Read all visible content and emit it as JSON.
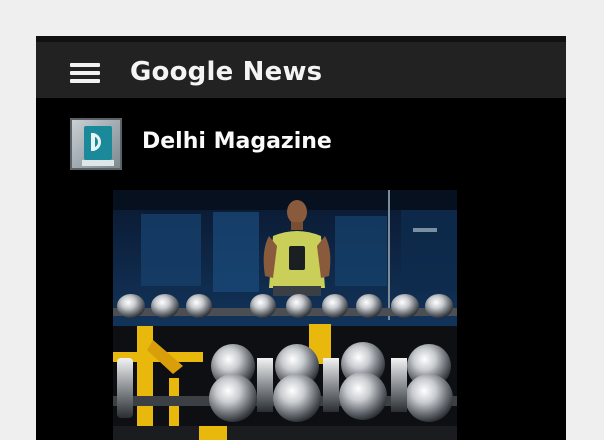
{
  "header": {
    "title": "Google News",
    "menu_icon": "hamburger-menu-icon"
  },
  "publisher": {
    "name": "Delhi Magazine",
    "logo_icon": "publisher-logo-icon"
  },
  "article": {
    "image_subject": "gym-mirror-selfie-with-dumbbell-rack"
  },
  "colors": {
    "page_background": "#efefef",
    "app_background": "#000000",
    "toolbar": "#222222",
    "text": "#f4f4f4",
    "accent_logo": "#1a8a9a",
    "rack_yellow": "#e8b80c"
  }
}
